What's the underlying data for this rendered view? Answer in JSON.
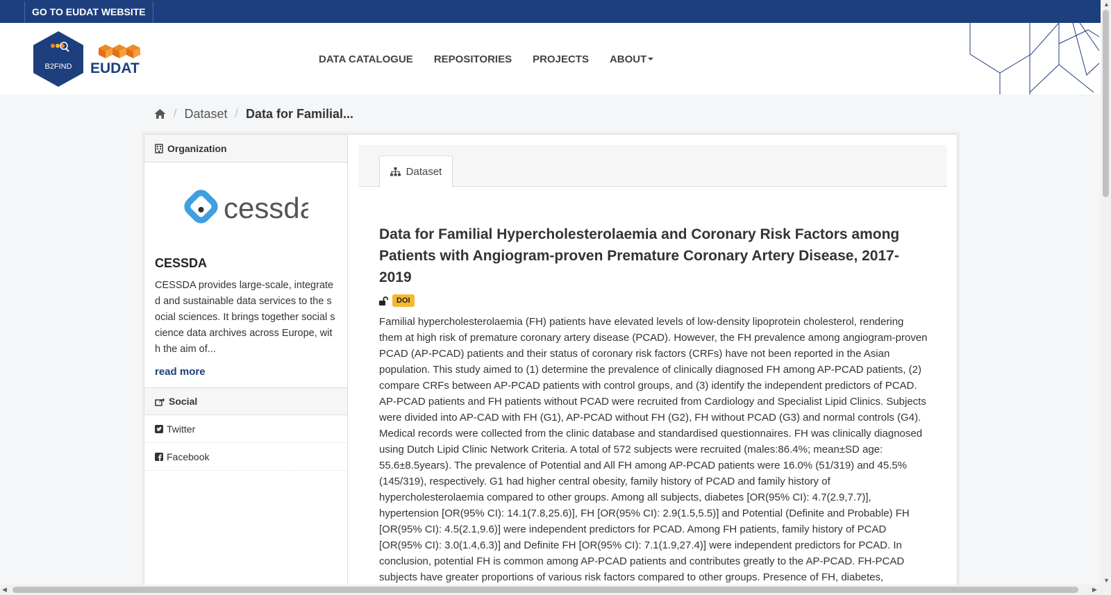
{
  "topbar": {
    "link_label": "GO TO EUDAT WEBSITE"
  },
  "header": {
    "logo_b2find": "B2FIND",
    "logo_eudat": "EUDAT",
    "nav": [
      "DATA CATALOGUE",
      "REPOSITORIES",
      "PROJECTS",
      "ABOUT"
    ]
  },
  "breadcrumb": {
    "items": [
      "Dataset",
      "Data for Familial..."
    ]
  },
  "sidebar": {
    "organization_heading": "Organization",
    "org_logo_text": "cessda",
    "org_name": "CESSDA",
    "org_description": "CESSDA provides large-scale, integrated and sustainable data services to the social sciences. It brings together social science data archives across Europe, with the aim of...",
    "read_more": "read more",
    "social_heading": "Social",
    "social_items": [
      "Twitter",
      "Facebook"
    ]
  },
  "content": {
    "tab_label": "Dataset",
    "title": "Data for Familial Hypercholesterolaemia and Coronary Risk Factors among Patients with Angiogram-proven Premature Coronary Artery Disease, 2017-2019",
    "badge": "DOI",
    "abstract": "Familial hypercholesterolaemia (FH) patients have elevated levels of low-density lipoprotein cholesterol, rendering them at high risk of premature coronary artery disease (PCAD). However, the FH prevalence among angiogram-proven PCAD (AP-PCAD) patients and their status of coronary risk factors (CRFs) have not been reported in the Asian population. This study aimed to (1) determine the prevalence of clinically diagnosed FH among AP-PCAD patients, (2) compare CRFs between AP-PCAD patients with control groups, and (3) identify the independent predictors of PCAD. AP-PCAD patients and FH patients without PCAD were recruited from Cardiology and Specialist Lipid Clinics. Subjects were divided into AP-CAD with FH (G1), AP-PCAD without FH (G2), FH without PCAD (G3) and normal controls (G4). Medical records were collected from the clinic database and standardised questionnaires. FH was clinically diagnosed using Dutch Lipid Clinic Network Criteria. A total of 572 subjects were recruited (males:86.4%; mean±SD age: 55.6±8.5years). The prevalence of Potential and All FH among AP-PCAD patients were 16.0% (51/319) and 45.5% (145/319), respectively. G1 had higher central obesity, family history of PCAD and family history of hypercholesterolaemia compared to other groups. Among all subjects, diabetes [OR(95% CI): 4.7(2.9,7.7)], hypertension [OR(95% CI): 14.1(7.8,25.6)], FH [OR(95% CI): 2.9(1.5,5.5)] and Potential (Definite and Probable) FH [OR(95% CI): 4.5(2.1,9.6)] were independent predictors for PCAD. Among FH patients, family history of PCAD [OR(95% CI): 3.0(1.4,6.3)] and Definite FH [OR(95% CI): 7.1(1.9,27.4)] were independent predictors for PCAD. In conclusion, potential FH is common among AP-PCAD patients and contributes greatly to the AP-PCAD. FH-PCAD subjects have greater proportions of various risk factors compared to other groups. Presence of FH, diabetes,"
  },
  "colors": {
    "brand_navy": "#1d3f7e",
    "eudat_orange": "#f08a1c",
    "doi_yellow": "#f5b82e",
    "cessda_blue": "#3f9fe0"
  }
}
